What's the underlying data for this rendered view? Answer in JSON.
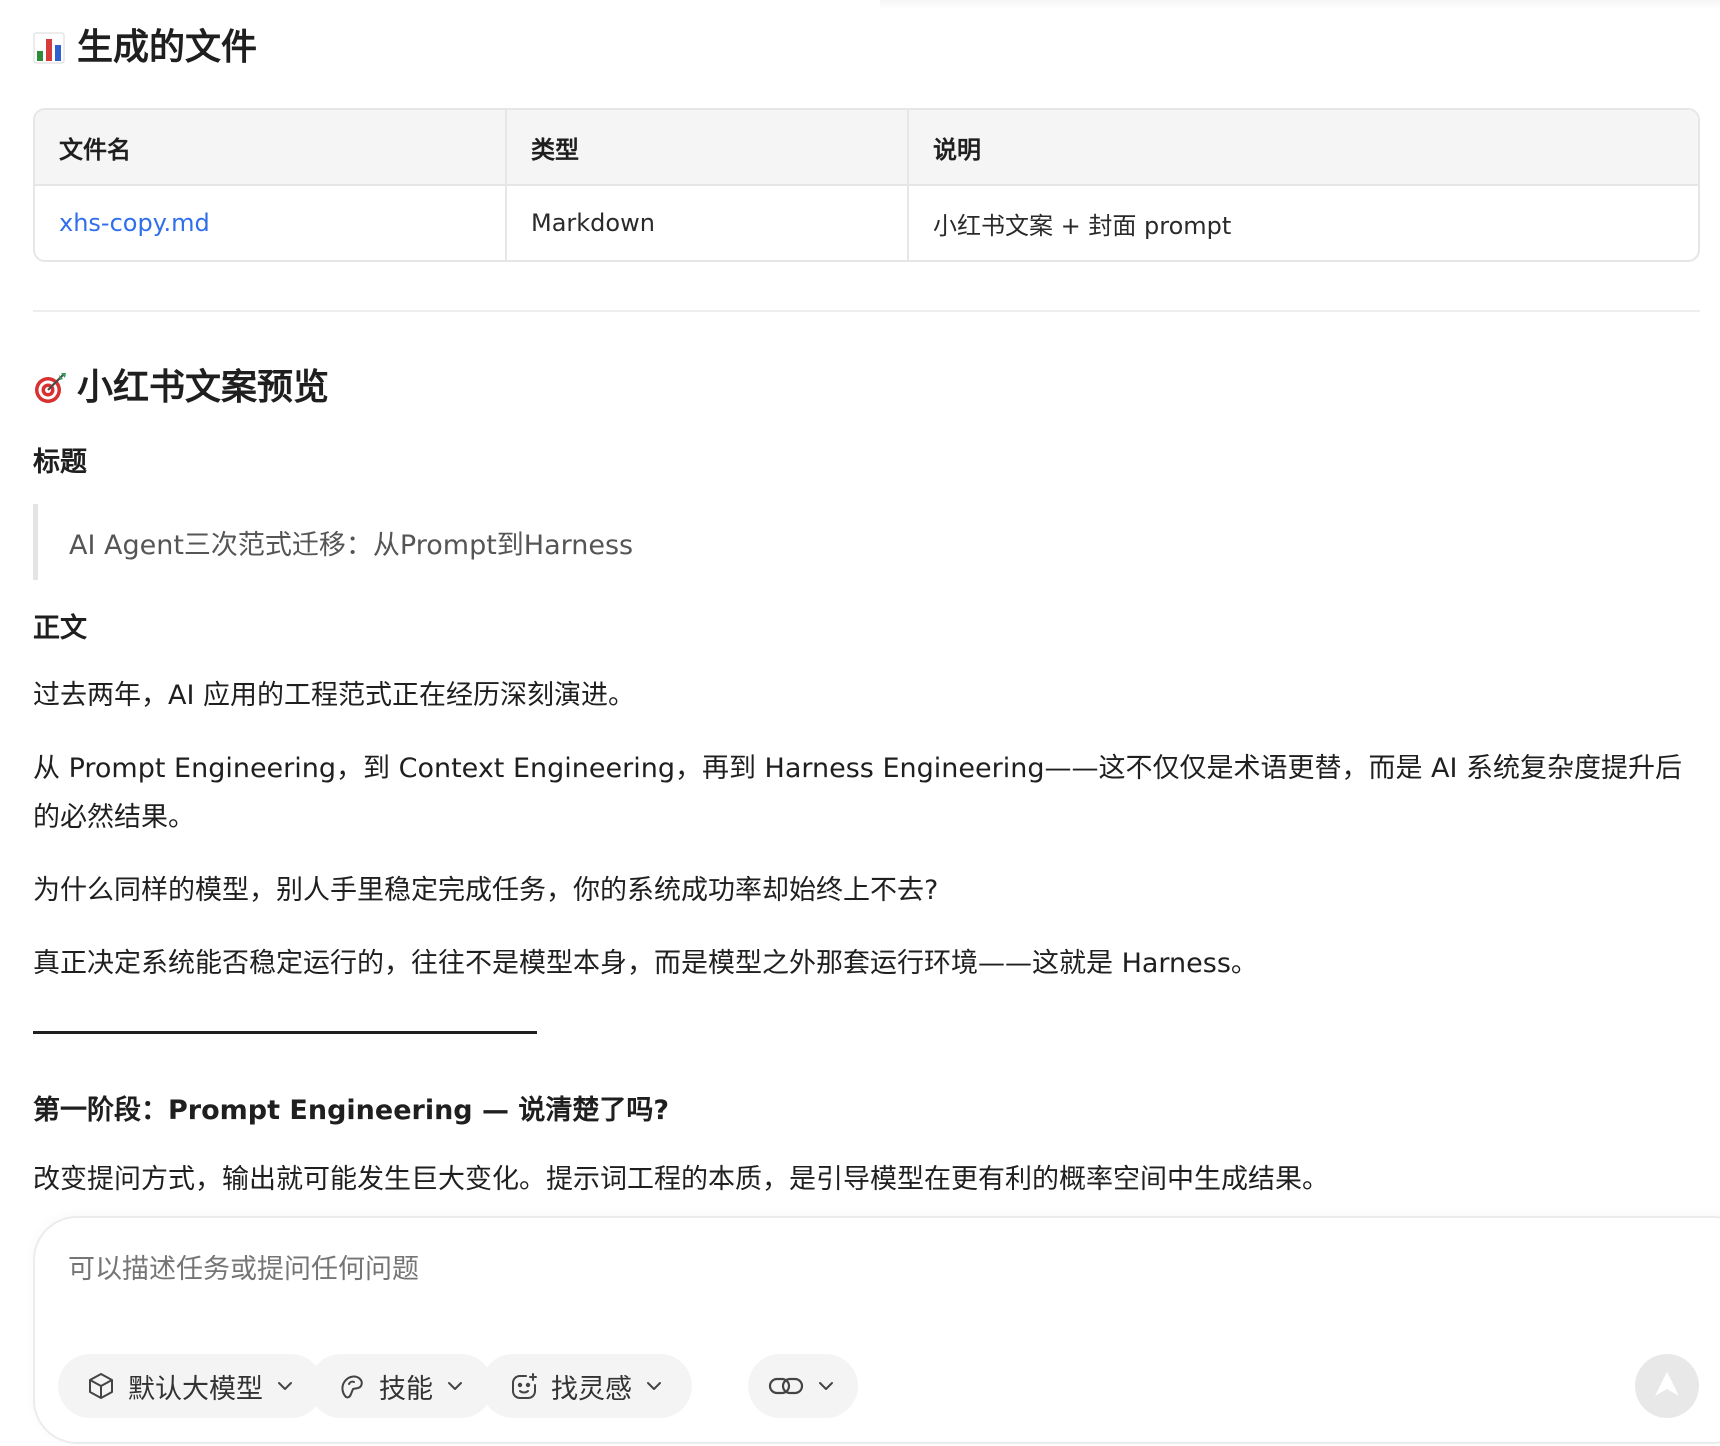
{
  "files_section": {
    "heading": "生成的文件",
    "icon": "bar-chart-emoji",
    "table": {
      "headers": [
        "文件名",
        "类型",
        "说明"
      ],
      "rows": [
        [
          "xhs-copy.md",
          "Markdown",
          "小红书文案 + 封面 prompt"
        ]
      ]
    }
  },
  "preview_section": {
    "heading": "小红书文案预览",
    "icon": "target-emoji",
    "title_label": "标题",
    "title_quote": "AI Agent三次范式迁移：从Prompt到Harness",
    "body_label": "正文",
    "paragraphs": [
      "过去两年，AI 应用的工程范式正在经历深刻演进。",
      "从 Prompt Engineering，到 Context Engineering，再到 Harness Engineering——这不仅仅是术语更替，而是 AI 系统复杂度提升后的必然结果。",
      "为什么同样的模型，别人手里稳定完成任务，你的系统成功率却始终上不去?",
      "真正决定系统能否稳定运行的，往往不是模型本身，而是模型之外那套运行环境——这就是 Harness。"
    ],
    "stage_title": "第一阶段：Prompt Engineering — 说清楚了吗?",
    "stage_paragraph": "改变提问方式，输出就可能发生巨大变化。提示词工程的本质，是引导模型在更有利的概率空间中生成结果。"
  },
  "composer": {
    "placeholder": "可以描述任务或提问任何问题",
    "model_label": "默认大模型",
    "skills_label": "技能",
    "inspiration_label": "找灵感"
  },
  "colors": {
    "link": "#2f6feb",
    "border": "#e6e6e6",
    "header_bg": "#f5f5f5",
    "chip_bg": "#f4f4f4"
  }
}
